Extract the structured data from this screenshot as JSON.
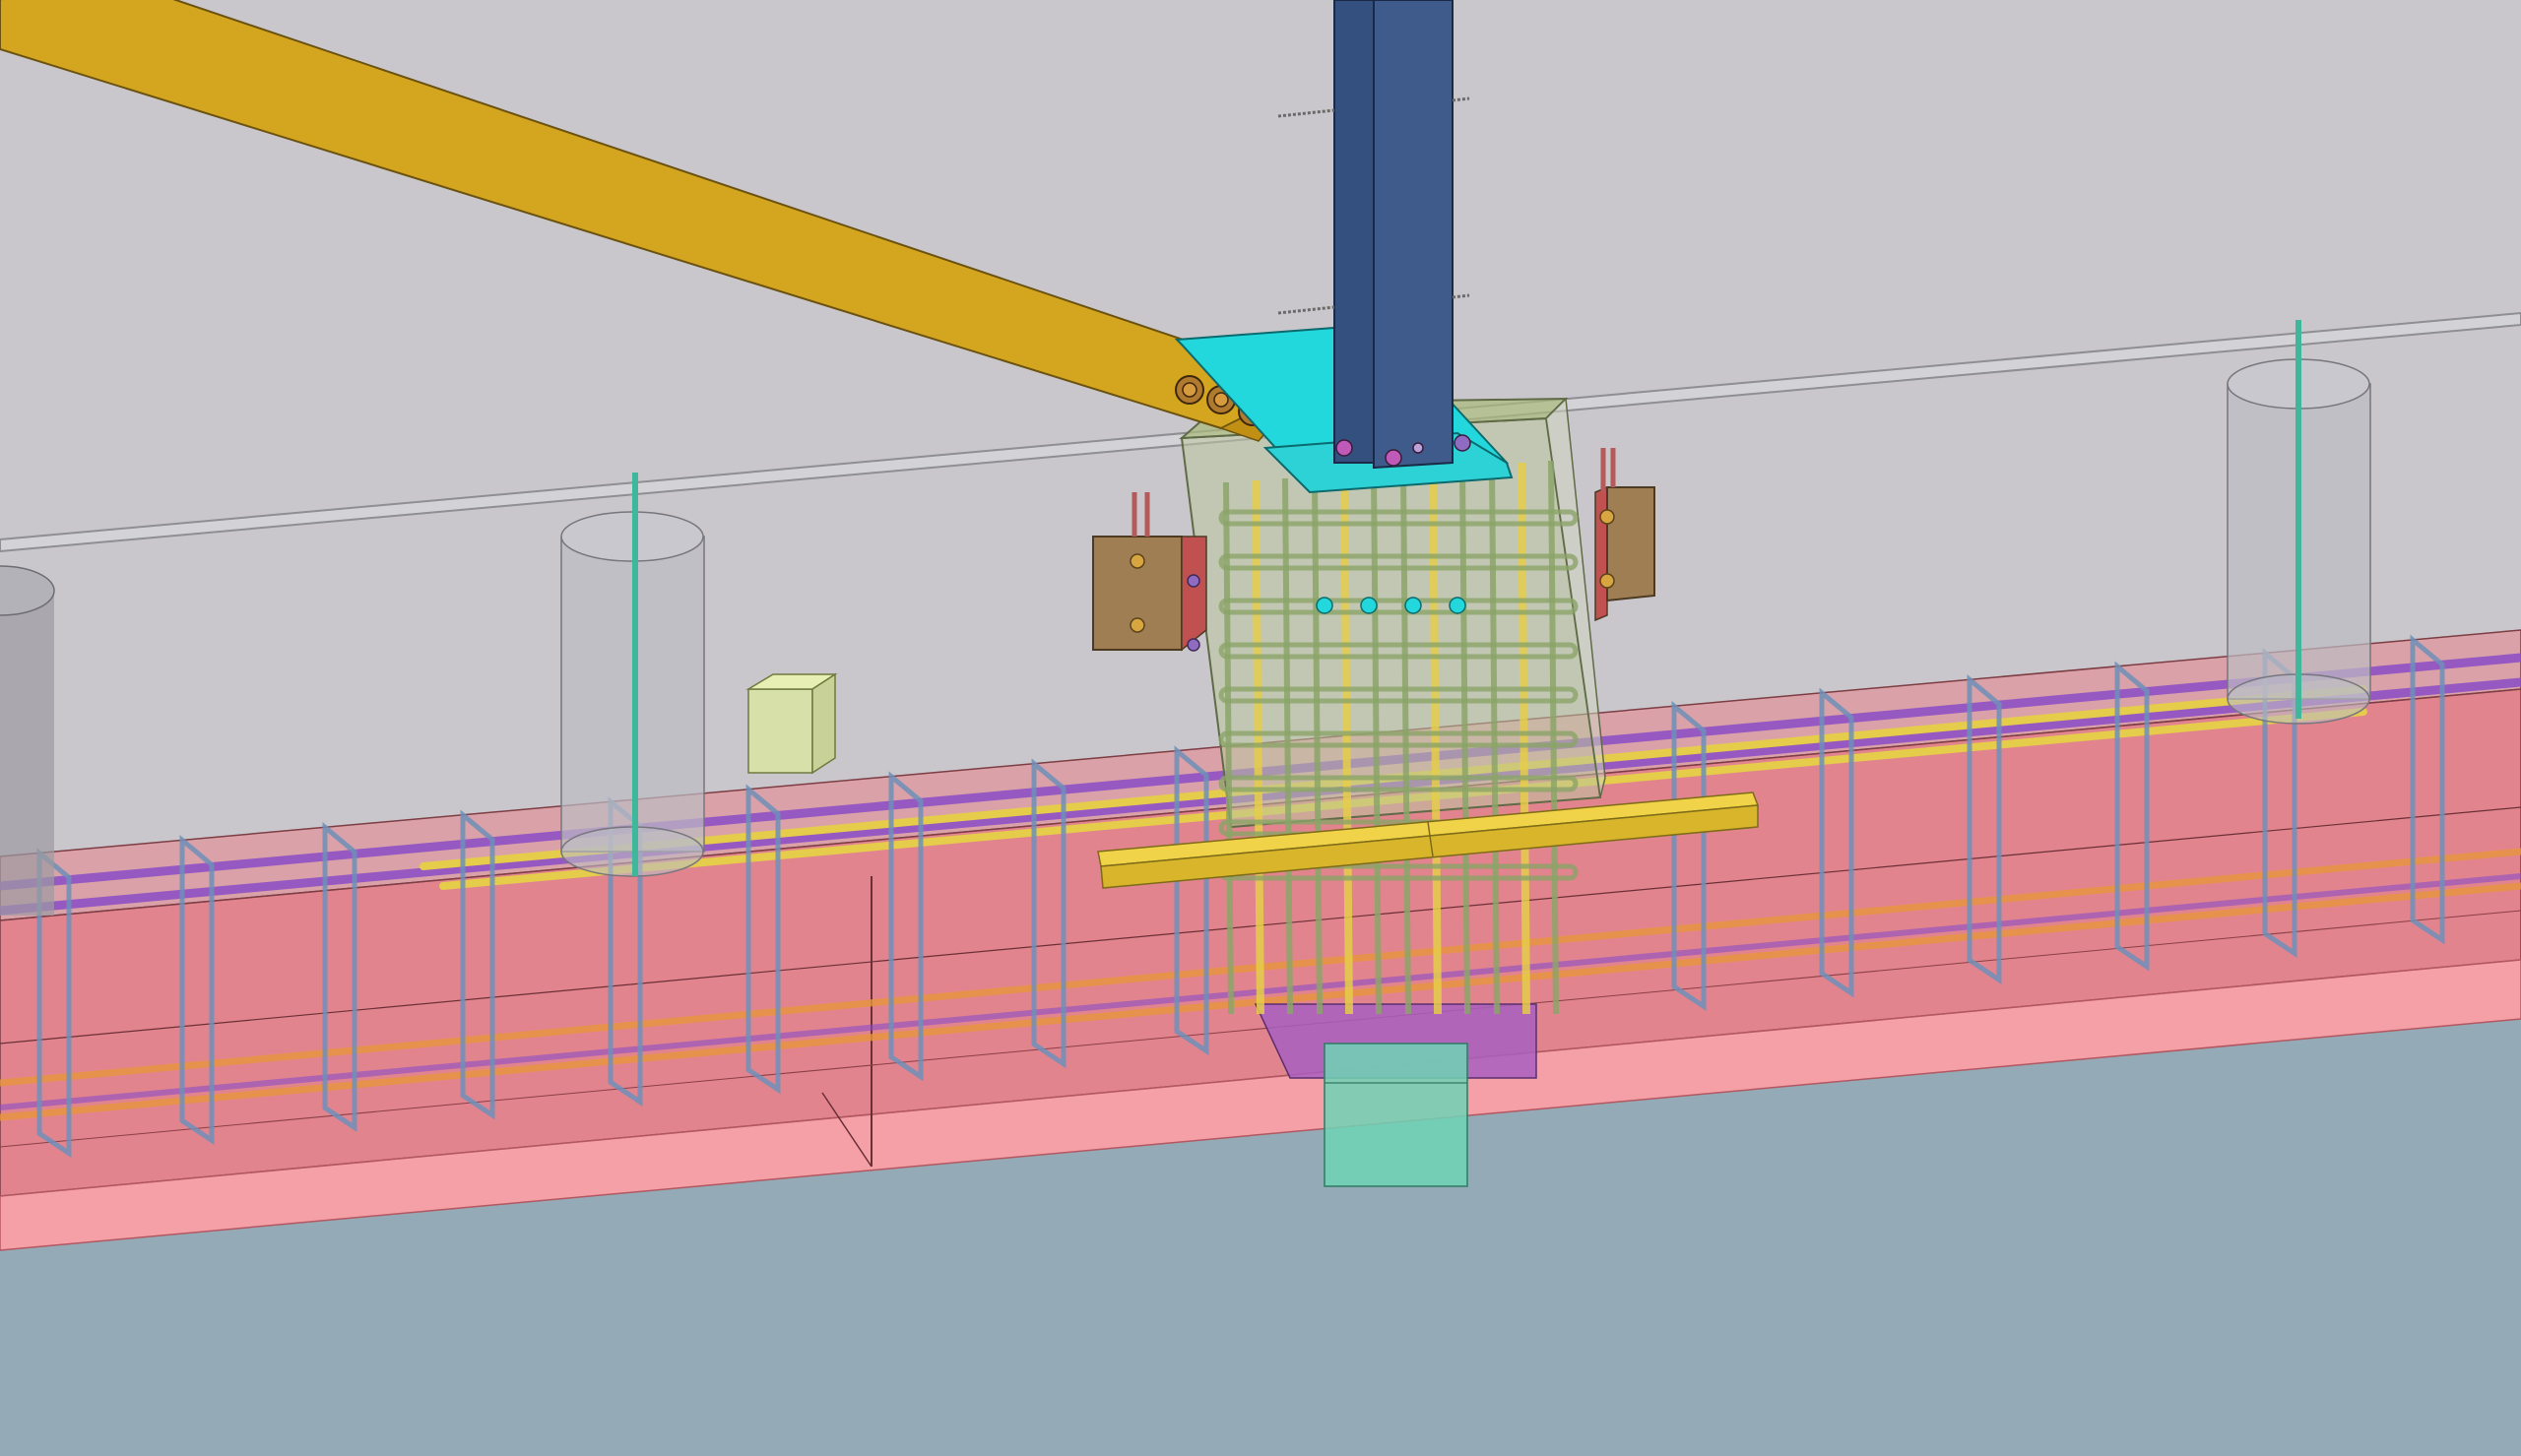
{
  "viewport": {
    "view_mode": "3d-perspective",
    "render_style": "shaded-transparent"
  },
  "colors": {
    "sky": "#c9c7cb",
    "ground": "#95aab7",
    "grade_beam": "#e9707b",
    "grade_beam_light": "#f29aa0",
    "brace": "#d4a51f",
    "column": "#3f5b8c",
    "gusset_plate": "#22d8dc",
    "pier_block": "#bcc7a0",
    "rebar_green": "#8ba468",
    "rebar_yellow": "#e5cc4a",
    "rebar_blue": "#6d8fb8",
    "rebar_purple": "#8a4cc7",
    "rebar_orange": "#e8963c",
    "side_plate": "#a07e54",
    "base_pad": "#a85fc0",
    "sub_pier": "#6fd3b5",
    "cylinder_pier": "#bdbcc3",
    "embed_box": "#dce6a0",
    "anchor_rod": "#3fb79a",
    "bolt": "#b07a2f"
  },
  "objects": [
    {
      "name": "steel-column",
      "kind": "steel"
    },
    {
      "name": "diagonal-brace",
      "kind": "steel"
    },
    {
      "name": "gusset-plate",
      "kind": "steel"
    },
    {
      "name": "concrete-pier",
      "kind": "concrete"
    },
    {
      "name": "grade-beam",
      "kind": "concrete"
    },
    {
      "name": "cylinder-pier-left",
      "kind": "concrete"
    },
    {
      "name": "cylinder-pier-mid",
      "kind": "concrete"
    },
    {
      "name": "cylinder-pier-right",
      "kind": "concrete"
    },
    {
      "name": "embed-box",
      "kind": "concrete"
    },
    {
      "name": "sub-pier",
      "kind": "concrete"
    }
  ]
}
